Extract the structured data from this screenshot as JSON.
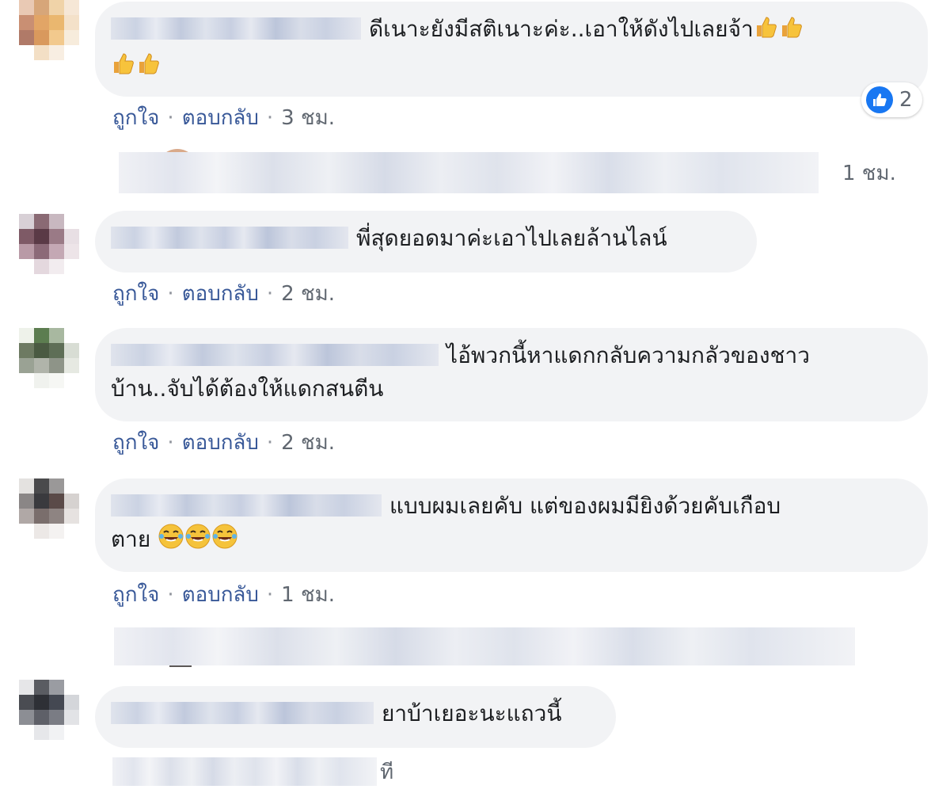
{
  "actions": {
    "like": "ถูกใจ",
    "reply": "ตอบกลับ",
    "separator": "·"
  },
  "reactions": {
    "count": "2",
    "type": "like-icon",
    "color": "#1877f2"
  },
  "comments": [
    {
      "text": "ดีเนาะยังมีสติเนาะค่ะ..เอาให้ดังไปเลยจ้า",
      "emoji": [
        "thumbs-up-icon",
        "thumbs-up-icon",
        "thumbs-up-icon",
        "thumbs-up-icon"
      ],
      "time": "3 ชม.",
      "reply_preview_time": "1 ชม."
    },
    {
      "text": "พี่สุดยอดมาค่ะเอาไปเลยล้านไลน์",
      "time": "2 ชม."
    },
    {
      "text_line1": "ไอ้พวกนี้หาแดกกลับความกลัวของชาว",
      "text_line2": "บ้าน..จับได้ต้องให้แดกสนตีน",
      "time": "2 ชม."
    },
    {
      "text_line1": "แบบผมเลยคับ แต่ของผมมียิงด้วยคับเกือบ",
      "text_line2": "ตาย",
      "emoji": [
        "laughing-tears-icon",
        "laughing-tears-icon",
        "laughing-tears-icon"
      ],
      "time": "1 ชม."
    },
    {
      "text": "ยาบ้าเยอะนะแถวนี้",
      "time_fragment": "ที"
    }
  ],
  "colors": {
    "bubble_bg": "#f2f3f5",
    "link": "#385898",
    "meta": "#606770",
    "text": "#1c1e21"
  }
}
